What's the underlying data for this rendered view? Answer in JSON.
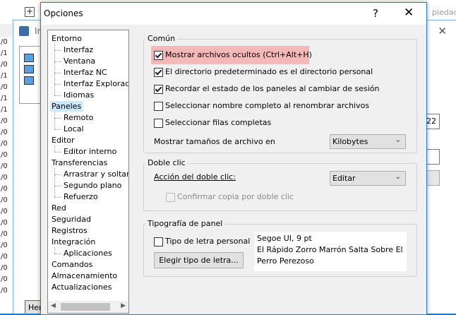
{
  "background": {
    "top_right_text": "piedad",
    "inner_title": "In",
    "number_value": "22",
    "bottom_button_label": "Her",
    "row_labels": [
      "/0",
      "/1",
      "/0",
      "/1",
      "/0",
      "/1",
      "/1",
      "/0",
      "/0",
      "/0",
      "/0",
      "/0",
      "/0",
      "/0",
      "/0",
      "/0",
      "/0",
      "/0",
      "/0",
      "/0",
      "/0",
      "/0",
      "/0"
    ]
  },
  "dialog": {
    "title": "Opciones",
    "help_glyph": "?",
    "close_glyph": "✕"
  },
  "tree": {
    "items": [
      {
        "label": "Entorno",
        "level": 0
      },
      {
        "label": "Interfaz",
        "level": 1
      },
      {
        "label": "Ventana",
        "level": 1
      },
      {
        "label": "Interfaz NC",
        "level": 1
      },
      {
        "label": "Interfaz Explorador",
        "level": 1
      },
      {
        "label": "Idiomas",
        "level": 1
      },
      {
        "label": "Paneles",
        "level": 0,
        "selected": true
      },
      {
        "label": "Remoto",
        "level": 1
      },
      {
        "label": "Local",
        "level": 1
      },
      {
        "label": "Editor",
        "level": 0
      },
      {
        "label": "Editor interno",
        "level": 1
      },
      {
        "label": "Transferencias",
        "level": 0
      },
      {
        "label": "Arrastrar y soltar",
        "level": 1
      },
      {
        "label": "Segundo plano",
        "level": 1
      },
      {
        "label": "Refuerzo",
        "level": 1
      },
      {
        "label": "Red",
        "level": 0
      },
      {
        "label": "Seguridad",
        "level": 0
      },
      {
        "label": "Registros",
        "level": 0
      },
      {
        "label": "Integración",
        "level": 0
      },
      {
        "label": "Aplicaciones",
        "level": 1
      },
      {
        "label": "Comandos",
        "level": 0
      },
      {
        "label": "Almacenamiento",
        "level": 0
      },
      {
        "label": "Actualizaciones",
        "level": 0
      }
    ]
  },
  "comun": {
    "title": "Común",
    "checkboxes": [
      {
        "label": "Mostrar archivos ocultos (Ctrl+Alt+H)",
        "checked": true,
        "highlighted": true
      },
      {
        "label": "El directorio predeterminado es el directorio personal",
        "checked": true
      },
      {
        "label": "Recordar el estado de los paneles al cambiar de sesión",
        "checked": true
      },
      {
        "label": "Seleccionar nombre completo al renombrar archivos",
        "checked": false
      },
      {
        "label": "Seleccionar filas completas",
        "checked": false
      }
    ],
    "size_label": "Mostrar tamaños de archivo en",
    "size_value": "Kilobytes"
  },
  "doble_clic": {
    "title": "Doble clic",
    "action_label": "Acción del doble clic:",
    "action_value": "Editar",
    "confirm_label": "Confirmar copia por doble clic",
    "confirm_checked": false,
    "confirm_disabled": true
  },
  "tipografia": {
    "title": "Tipografía de panel",
    "custom_font_label": "Tipo de letra personal",
    "custom_font_checked": false,
    "choose_button": "Elegir tipo de letra...",
    "font_name": "Segoe UI, 9 pt",
    "sample_line1": "El Rápido Zorro Marrón Salta Sobre El",
    "sample_line2": "Perro Perezoso"
  },
  "colors": {
    "accent": "#1979c9",
    "highlight": "#f4b8b8",
    "selected_tree": "#cce8ff"
  }
}
